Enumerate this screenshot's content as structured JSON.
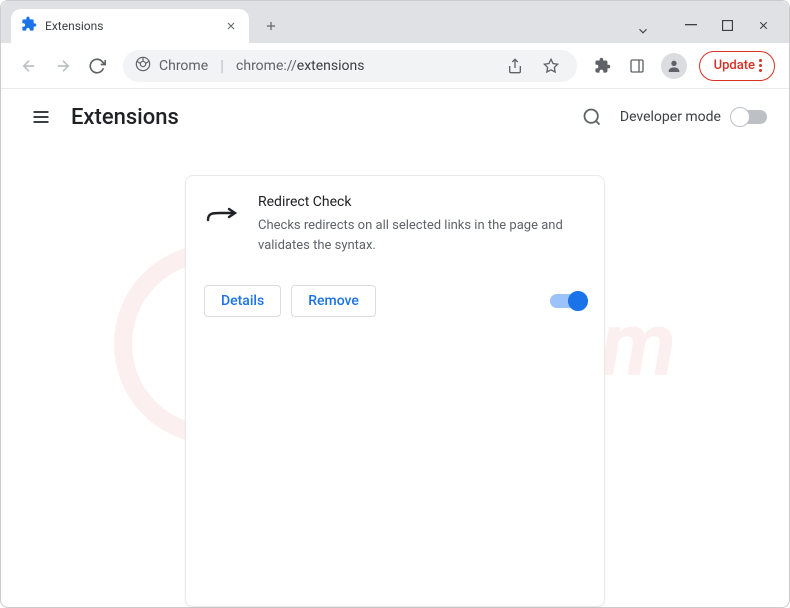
{
  "tab": {
    "title": "Extensions"
  },
  "omnibox": {
    "prefix": "Chrome",
    "url": "chrome://extensions",
    "url_scheme": "chrome://",
    "url_path": "extensions"
  },
  "toolbar": {
    "update_label": "Update"
  },
  "page": {
    "title": "Extensions",
    "dev_mode_label": "Developer mode",
    "dev_mode_on": false
  },
  "extension": {
    "name": "Redirect Check",
    "description": "Checks redirects on all selected links in the page and validates the syntax.",
    "details_label": "Details",
    "remove_label": "Remove",
    "enabled": true
  }
}
